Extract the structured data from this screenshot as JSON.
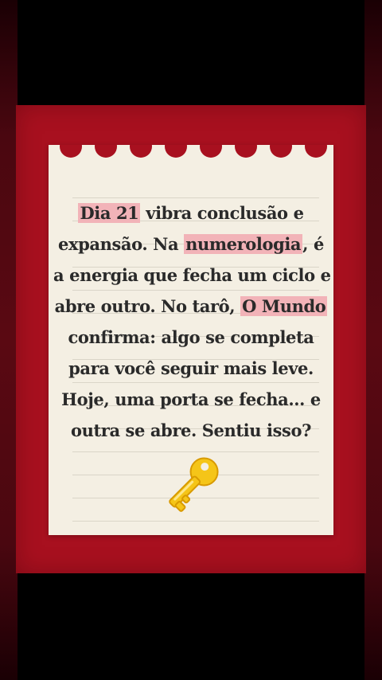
{
  "note": {
    "lines": [
      {
        "pre": "",
        "hl": "Dia 21",
        "post": " vibra conclusão e"
      },
      {
        "pre": "expansão. Na ",
        "hl": "numerologia",
        "post": ", é"
      },
      {
        "pre": "a energia que fecha um ciclo e",
        "hl": "",
        "post": ""
      },
      {
        "pre": "abre outro. No tarô, ",
        "hl": "O Mundo",
        "post": ""
      },
      {
        "pre": "confirma: algo se completa",
        "hl": "",
        "post": ""
      },
      {
        "pre": "para você seguir mais leve.",
        "hl": "",
        "post": ""
      },
      {
        "pre": "Hoje, uma porta se fecha… e",
        "hl": "",
        "post": ""
      },
      {
        "pre": "outra se abre. Sentiu isso?",
        "hl": "",
        "post": ""
      }
    ],
    "emoji": "key-icon"
  },
  "colors": {
    "panel": "#a8101f",
    "paper": "#f4efe3",
    "highlight": "#f2b3b8",
    "text": "#2a2a2a",
    "key_gold": "#f5c518"
  }
}
